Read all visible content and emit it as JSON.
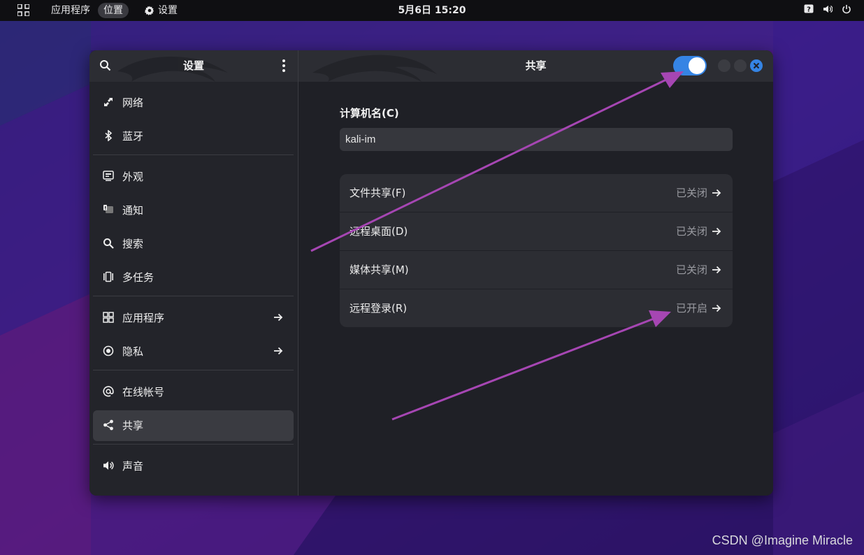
{
  "topbar": {
    "activities_icon": "apps-grid-icon",
    "apps_label": "应用程序",
    "places_label": "位置",
    "settings_label": "设置",
    "settings_icon": "gear-icon",
    "clock": "5月6日  15:20",
    "status_icons": [
      "help-icon",
      "volume-icon",
      "power-icon"
    ]
  },
  "sidebar": {
    "title": "设置",
    "search_icon": "search-icon",
    "menu_icon": "more-vertical-icon",
    "items": [
      {
        "label": "网络",
        "icon": "network-icon"
      },
      {
        "label": "蓝牙",
        "icon": "bluetooth-icon"
      },
      {
        "label": "外观",
        "icon": "appearance-icon"
      },
      {
        "label": "通知",
        "icon": "notifications-icon"
      },
      {
        "label": "搜索",
        "icon": "search-icon"
      },
      {
        "label": "多任务",
        "icon": "multitasking-icon"
      },
      {
        "label": "应用程序",
        "icon": "apps-icon",
        "has_arrow": true
      },
      {
        "label": "隐私",
        "icon": "privacy-icon",
        "has_arrow": true
      },
      {
        "label": "在线帐号",
        "icon": "at-icon"
      },
      {
        "label": "共享",
        "icon": "share-icon",
        "active": true
      },
      {
        "label": "声音",
        "icon": "speaker-icon"
      }
    ]
  },
  "main": {
    "title": "共享",
    "sharing_toggle_on": true,
    "computer_name_label": "计算机名(C)",
    "computer_name_value": "kali-im",
    "rows": [
      {
        "label": "文件共享(F)",
        "status": "已关闭"
      },
      {
        "label": "远程桌面(D)",
        "status": "已关闭"
      },
      {
        "label": "媒体共享(M)",
        "status": "已关闭"
      },
      {
        "label": "远程登录(R)",
        "status": "已开启"
      }
    ]
  },
  "colors": {
    "accent": "#3584e4",
    "annotation_arrow": "#a646b3"
  },
  "watermark": "CSDN @Imagine Miracle"
}
